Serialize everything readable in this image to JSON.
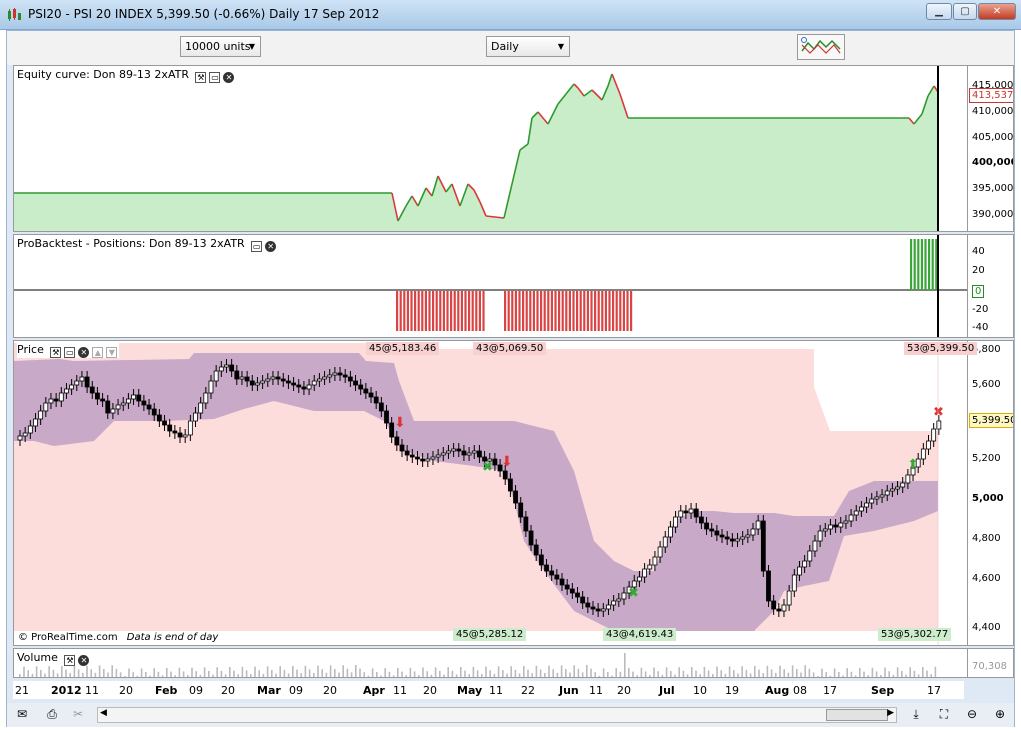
{
  "window": {
    "title": "PSI20 - PSI 20 INDEX     5,399.50 (-0.66%)     Daily  17 Sep 2012"
  },
  "toolbar": {
    "units_select": "10000 units",
    "period_select": "Daily"
  },
  "equity_panel": {
    "label": "Equity curve: Don 89-13 2xATR",
    "axis": [
      "415,000",
      "410,000",
      "405,000",
      "400,000",
      "395,000",
      "390,000"
    ],
    "current_value": "413,537"
  },
  "positions_panel": {
    "label": "ProBacktest - Positions: Don 89-13 2xATR",
    "axis": [
      "40",
      "20",
      "0",
      "-20",
      "-40"
    ]
  },
  "price_panel": {
    "label": "Price",
    "axis": [
      "5,800",
      "5,600",
      "5,400",
      "5,200",
      "5,000",
      "4,800",
      "4,600",
      "4,400"
    ],
    "current_value": "5,399.50",
    "trades": [
      {
        "text": "45@5,183.46",
        "type": "entry-short"
      },
      {
        "text": "43@5,069.50",
        "type": "entry-short"
      },
      {
        "text": "53@5,399.50",
        "type": "exit-long"
      },
      {
        "text": "45@5,285.12",
        "type": "exit-short"
      },
      {
        "text": "43@4,619.43",
        "type": "exit-short"
      },
      {
        "text": "53@5,302.77",
        "type": "entry-long"
      }
    ],
    "copyright": "© ProRealTime.com",
    "note": "Data is end of day"
  },
  "volume_panel": {
    "label": "Volume",
    "current_value": "70,308"
  },
  "date_axis": [
    "21",
    "2012",
    "11",
    "20",
    "Feb",
    "09",
    "20",
    "Mar",
    "09",
    "20",
    "Apr",
    "11",
    "20",
    "May",
    "11",
    "22",
    "Jun",
    "11",
    "20",
    "Jul",
    "10",
    "19",
    "Aug",
    "08",
    "17",
    "Sep",
    "17"
  ],
  "colors": {
    "equity_fill": "#c8edc8",
    "equity_up": "#2e9a2e",
    "equity_down": "#d83a3a",
    "channel_outer": "#fddcdc",
    "channel_inner": "#c9a9c8",
    "short_bar": "#d94545",
    "long_bar": "#3aa63a"
  }
}
